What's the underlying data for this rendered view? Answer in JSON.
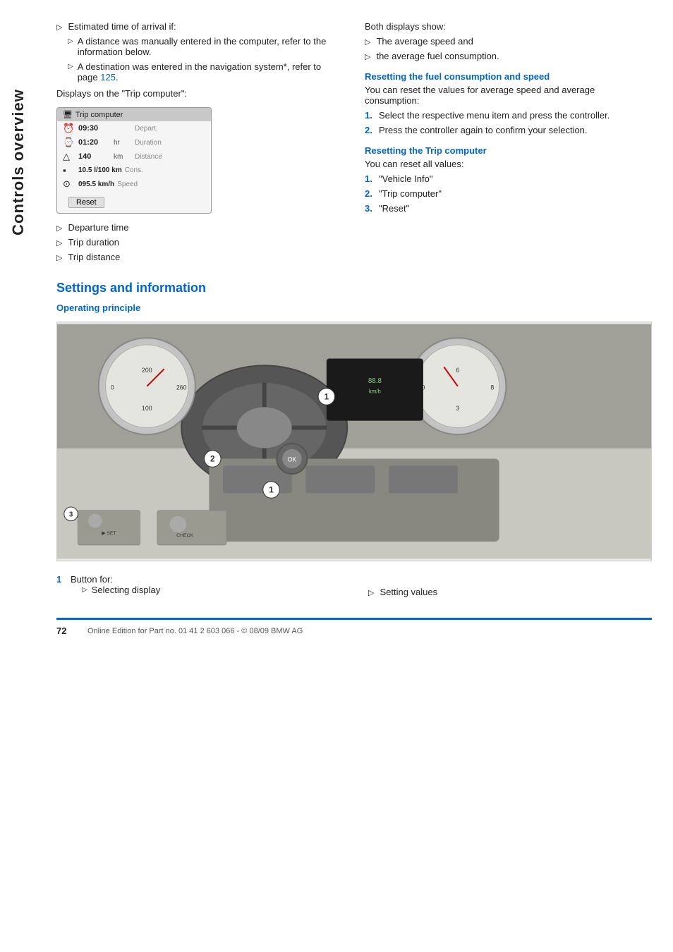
{
  "sidebar": {
    "label": "Controls overview"
  },
  "left_col": {
    "intro_bullet": "Estimated time of arrival if:",
    "sub_bullets": [
      "A distance was manually entered in the computer, refer to the information below.",
      "A destination was entered in the navigation system*, refer to page 125."
    ],
    "displays_label": "Displays on the \"Trip computer\":",
    "trip_computer": {
      "title": "Trip computer",
      "rows": [
        {
          "icon": "⏰",
          "value": "09:30",
          "unit": "",
          "label": "Depart."
        },
        {
          "icon": "⌚",
          "value": "01:20",
          "unit": "hr",
          "label": "Duration"
        },
        {
          "icon": "△",
          "value": "140",
          "unit": "km",
          "label": "Distance"
        },
        {
          "icon": "🔴",
          "value": "10.5 l/100 km",
          "unit": "",
          "label": "Cons."
        },
        {
          "icon": "⊙",
          "value": "095.5 km/h",
          "unit": "",
          "label": "Speed"
        }
      ],
      "reset_label": "Reset"
    },
    "bottom_bullets": [
      "Departure time",
      "Trip duration",
      "Trip distance"
    ]
  },
  "right_col": {
    "both_displays_label": "Both displays show:",
    "both_bullets": [
      "The average speed and",
      "the average fuel consumption."
    ],
    "fuel_section": {
      "heading": "Resetting the fuel consumption and speed",
      "intro": "You can reset the values for average speed and average consumption:",
      "steps": [
        "Select the respective menu item and press the controller.",
        "Press the controller again to confirm your selection."
      ]
    },
    "trip_section": {
      "heading": "Resetting the Trip computer",
      "intro": "You can reset all values:",
      "steps": [
        "\"Vehicle Info\"",
        "\"Trip computer\"",
        "\"Reset\""
      ]
    }
  },
  "settings_section": {
    "heading": "Settings and information",
    "sub_heading": "Operating principle",
    "dashboard_image_alt": "BMW dashboard controls overview image",
    "captions": {
      "left": {
        "num": "1",
        "label": "Button for:",
        "bullets": [
          "Selecting display"
        ]
      },
      "right": {
        "bullets": [
          "Setting values"
        ]
      }
    }
  },
  "footer": {
    "page_number": "72",
    "text": "Online Edition for Part no. 01 41 2 603 066 - © 08/09 BMW AG"
  }
}
